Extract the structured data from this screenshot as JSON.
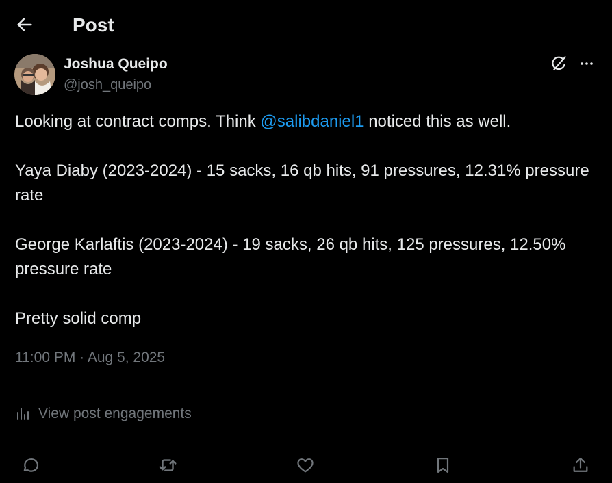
{
  "header": {
    "title": "Post",
    "back_icon": "arrow-left-icon"
  },
  "author": {
    "display_name": "Joshua Queipo",
    "handle": "@josh_queipo",
    "avatar_icon": "avatar-photo"
  },
  "post": {
    "paragraphs": {
      "p1_before": "Looking at contract comps. Think ",
      "p1_mention": "@salibdaniel1",
      "p1_after": " noticed this as well.",
      "p2": "Yaya Diaby (2023-2024) - 15 sacks, 16 qb hits, 91 pressures, 12.31% pressure rate",
      "p3": "George Karlaftis (2023-2024) - 19 sacks, 26 qb hits, 125 pressures, 12.50% pressure rate",
      "p4": "Pretty solid comp"
    },
    "time": "11:00 PM",
    "separator": " · ",
    "date": "Aug 5, 2025"
  },
  "engagements": {
    "label": "View post engagements",
    "icon": "bar-chart-icon"
  },
  "actions": [
    {
      "icon": "reply-icon"
    },
    {
      "icon": "repost-icon"
    },
    {
      "icon": "like-icon"
    },
    {
      "icon": "bookmark-icon"
    },
    {
      "icon": "share-icon"
    }
  ],
  "colors": {
    "background": "#000000",
    "text": "#e7e9ea",
    "secondary": "#71767b",
    "link": "#1d9bf0",
    "divider": "#2f3336"
  }
}
